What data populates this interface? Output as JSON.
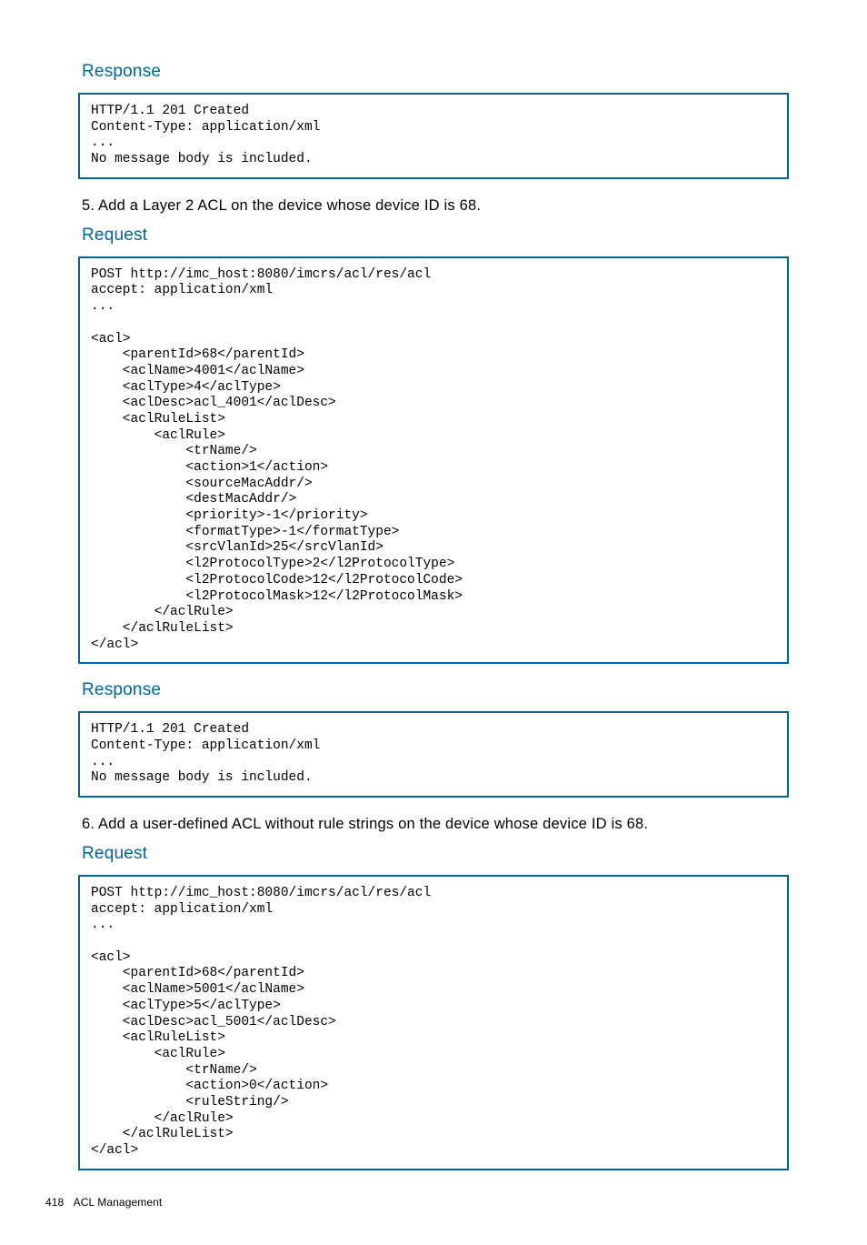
{
  "sections": [
    {
      "heading": "Response",
      "code": "HTTP/1.1 201 Created\nContent-Type: application/xml\n...\nNo message body is included."
    },
    {
      "body": "5. Add a Layer 2 ACL on the device whose device ID is 68."
    },
    {
      "heading": "Request",
      "code": "POST http://imc_host:8080/imcrs/acl/res/acl\naccept: application/xml\n...\n\n<acl>\n    <parentId>68</parentId>\n    <aclName>4001</aclName>\n    <aclType>4</aclType>\n    <aclDesc>acl_4001</aclDesc>\n    <aclRuleList>\n        <aclRule>\n            <trName/>\n            <action>1</action>\n            <sourceMacAddr/>\n            <destMacAddr/>\n            <priority>-1</priority>\n            <formatType>-1</formatType>\n            <srcVlanId>25</srcVlanId>\n            <l2ProtocolType>2</l2ProtocolType>\n            <l2ProtocolCode>12</l2ProtocolCode>\n            <l2ProtocolMask>12</l2ProtocolMask>\n        </aclRule>\n    </aclRuleList>\n</acl>"
    },
    {
      "heading": "Response",
      "code": "HTTP/1.1 201 Created\nContent-Type: application/xml\n...\nNo message body is included."
    },
    {
      "body": "6. Add a user-defined ACL without rule strings on the device whose device ID is 68."
    },
    {
      "heading": "Request",
      "code": "POST http://imc_host:8080/imcrs/acl/res/acl\naccept: application/xml\n...\n\n<acl>\n    <parentId>68</parentId>\n    <aclName>5001</aclName>\n    <aclType>5</aclType>\n    <aclDesc>acl_5001</aclDesc>\n    <aclRuleList>\n        <aclRule>\n            <trName/>\n            <action>0</action>\n            <ruleString/>\n        </aclRule>\n    </aclRuleList>\n</acl>"
    }
  ],
  "footer": {
    "page_number": "418",
    "chapter": "ACL Management"
  }
}
